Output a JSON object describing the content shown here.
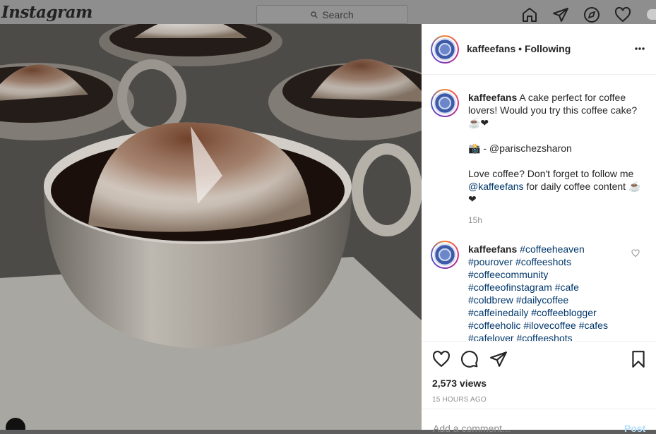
{
  "app": {
    "logo_text": "Instagram"
  },
  "search": {
    "placeholder": "Search"
  },
  "post": {
    "username": "kaffeefans",
    "follow_status": "Following",
    "separator": "•",
    "more_icon": "more-horizontal-icon",
    "caption_line1": "A cake perfect for coffee lovers! Would you try this coffee cake? ☕❤",
    "caption_credit": "📸 - @parischezsharon",
    "caption_line2_prefix": "Love coffee? Don't forget to follow me",
    "caption_mention": "@kaffeefans",
    "caption_line2_suffix": "for daily coffee content ☕❤",
    "caption_time": "15h",
    "comment": {
      "username": "kaffeefans",
      "hashtags": [
        "#coffeeheaven",
        "#pourover",
        "#coffeeshots",
        "#coffeecommunity",
        "#coffeeofinstagram",
        "#cafe",
        "#coldbrew",
        "#dailycoffee",
        "#caffeinedaily",
        "#coffeeblogger",
        "#coffeeholic",
        "#ilovecoffee",
        "#cafes",
        "#cafelover",
        "#coffeeshots"
      ]
    },
    "views": "2,573 views",
    "timestamp": "15 HOURS AGO",
    "comment_placeholder": "Add a comment...",
    "post_button": "Post"
  },
  "colors": {
    "link": "#00376b",
    "muted": "#8e8e8e",
    "text": "#262626",
    "post_button": "#b2dffc"
  }
}
